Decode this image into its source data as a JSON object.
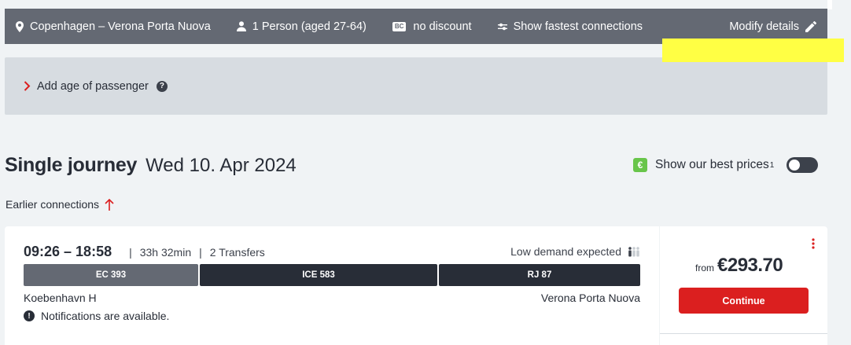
{
  "search_summary": {
    "route": "Copenhagen – Verona Porta Nuova",
    "passengers": "1 Person (aged 27-64)",
    "discount_badge": "BC",
    "discount": "no discount",
    "connection_pref": "Show fastest connections",
    "modify_label": "Modify details",
    "icons": [
      "location-pin-icon",
      "person-icon",
      "bahncard-icon",
      "sliders-icon",
      "pencil-icon"
    ]
  },
  "age_panel": {
    "label": "Add age of passenger",
    "help_glyph": "?"
  },
  "journey": {
    "title": "Single journey",
    "date": "Wed 10. Apr 2024"
  },
  "best_prices": {
    "icon_glyph": "€",
    "label": "Show our best prices",
    "footnote": "1",
    "enabled": false
  },
  "earlier_connections": "Earlier connections",
  "connection": {
    "times": "09:26 – 18:58",
    "duration": "33h 32min",
    "transfers": "2 Transfers",
    "demand": "Low demand expected",
    "segments": [
      "EC 393",
      "ICE 583",
      "RJ 87"
    ],
    "origin": "Koebenhavn H",
    "destination": "Verona Porta Nuova",
    "notification": "Notifications are available.",
    "notification_glyph": "!",
    "price_prefix": "from",
    "price": "€293.70",
    "continue_label": "Continue"
  },
  "colors": {
    "header_bg": "#646973",
    "panel_bg": "#d7dce1",
    "page_bg": "#f0f3f5",
    "accent_red": "#db1f1f",
    "best_price_green": "#68c54a",
    "highlight_yellow": "#ffff44"
  }
}
